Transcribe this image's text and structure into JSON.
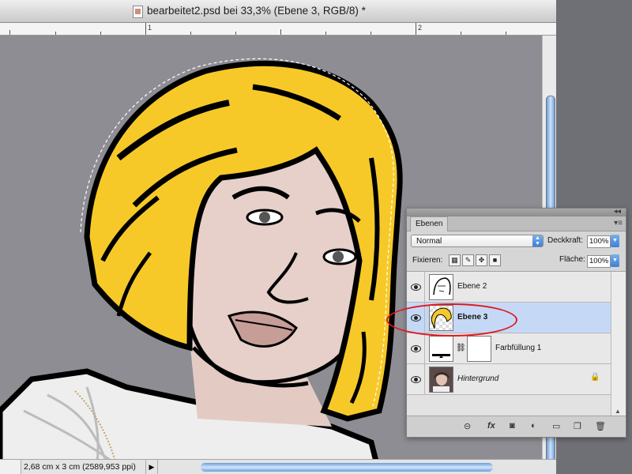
{
  "window": {
    "title": "bearbeitet2.psd bei 33,3% (Ebene 3, RGB/8) *"
  },
  "ruler": {
    "labels": [
      "1",
      "2"
    ]
  },
  "status": {
    "doc_info": "2,68 cm x 3 cm (2589,953 ppi)",
    "arrow": "▶"
  },
  "layers_panel": {
    "tab_label": "Ebenen",
    "blend_mode": "Normal",
    "opacity_label": "Deckkraft:",
    "opacity_value": "100%",
    "lock_label": "Fixieren:",
    "fill_label": "Fläche:",
    "fill_value": "100%",
    "layers": [
      {
        "name": "Ebene 2",
        "visible": true,
        "selected": false
      },
      {
        "name": "Ebene 3",
        "visible": true,
        "selected": true
      },
      {
        "name": "Farbfüllung 1",
        "visible": true,
        "selected": false
      },
      {
        "name": "Hintergrund",
        "visible": true,
        "selected": false,
        "locked": true
      }
    ],
    "footer_icons": [
      "link-icon",
      "fx-icon",
      "mask-icon",
      "adjustment-icon",
      "folder-icon",
      "new-layer-icon",
      "trash-icon"
    ],
    "fx_label": "fx"
  },
  "colors": {
    "hair": "#f7c928",
    "selection_highlight": "#e0191d",
    "selected_layer": "#c5d9f6"
  }
}
